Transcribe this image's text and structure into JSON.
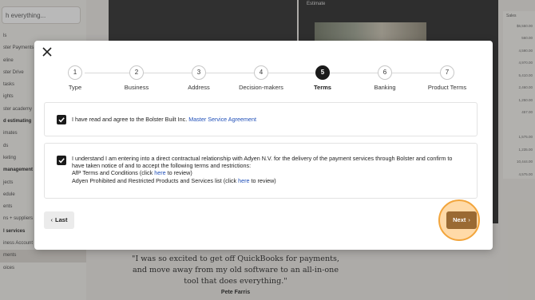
{
  "background": {
    "search_placeholder": "h everything...",
    "nav_items": [
      {
        "label": "ls"
      },
      {
        "label": "ster Payments"
      },
      {
        "label": "eline"
      },
      {
        "label": "ster Drive"
      },
      {
        "label": "tasks"
      },
      {
        "label": "ights"
      },
      {
        "label": "ster academy"
      },
      {
        "label": "d estimating"
      },
      {
        "label": "imates"
      },
      {
        "label": "ds"
      },
      {
        "label": "keting"
      },
      {
        "label": "management"
      },
      {
        "label": "jects"
      },
      {
        "label": "edule"
      },
      {
        "label": "ents"
      },
      {
        "label": "ns + suppliers"
      },
      {
        "label": "l services"
      },
      {
        "label": "iness Account"
      },
      {
        "label": "ments"
      },
      {
        "label": "oices"
      }
    ],
    "photo_header": "Estimate",
    "table_header": "Sales",
    "table_values": [
      "$6,550.00",
      "560.00",
      "4,590.00",
      "4,970.00",
      "5,410.00",
      "2,460.00",
      "1,250.00",
      "457.00",
      "",
      "1,575.00",
      "1,235.00",
      "10,444.00",
      "4,575.00"
    ],
    "quote": "\"I was so excited to get off QuickBooks for payments, and move away from my old software to an all-in-one tool that does everything.\"",
    "quote_author": "Pete Farris"
  },
  "modal": {
    "steps": [
      {
        "number": "1",
        "label": "Type"
      },
      {
        "number": "2",
        "label": "Business"
      },
      {
        "number": "3",
        "label": "Address"
      },
      {
        "number": "4",
        "label": "Decision-makers"
      },
      {
        "number": "5",
        "label": "Terms"
      },
      {
        "number": "6",
        "label": "Banking"
      },
      {
        "number": "7",
        "label": "Product Terms"
      }
    ],
    "current_step": 5,
    "term1": {
      "text": "I have read and agree to the Bolster Built Inc. ",
      "link": "Master Service Agreement",
      "checked": true
    },
    "term2": {
      "text": "I understand I am entering into a direct contractual relationship with Adyen N.V. for the delivery of the payment services through Bolster and confirm to have taken notice of and to accept the following terms and restrictions:",
      "line2_prefix": "AfP Terms and Conditions (click ",
      "line2_link": "here",
      "line2_suffix": " to review)",
      "line3_prefix": "Adyen Prohibited and Restricted Products and Services list (click ",
      "line3_link": "here",
      "line3_suffix": " to review)",
      "checked": true
    },
    "last_label": "Last",
    "next_label": "Next",
    "accent_color": "#9a6a33",
    "highlight_color": "#f2a53c"
  }
}
